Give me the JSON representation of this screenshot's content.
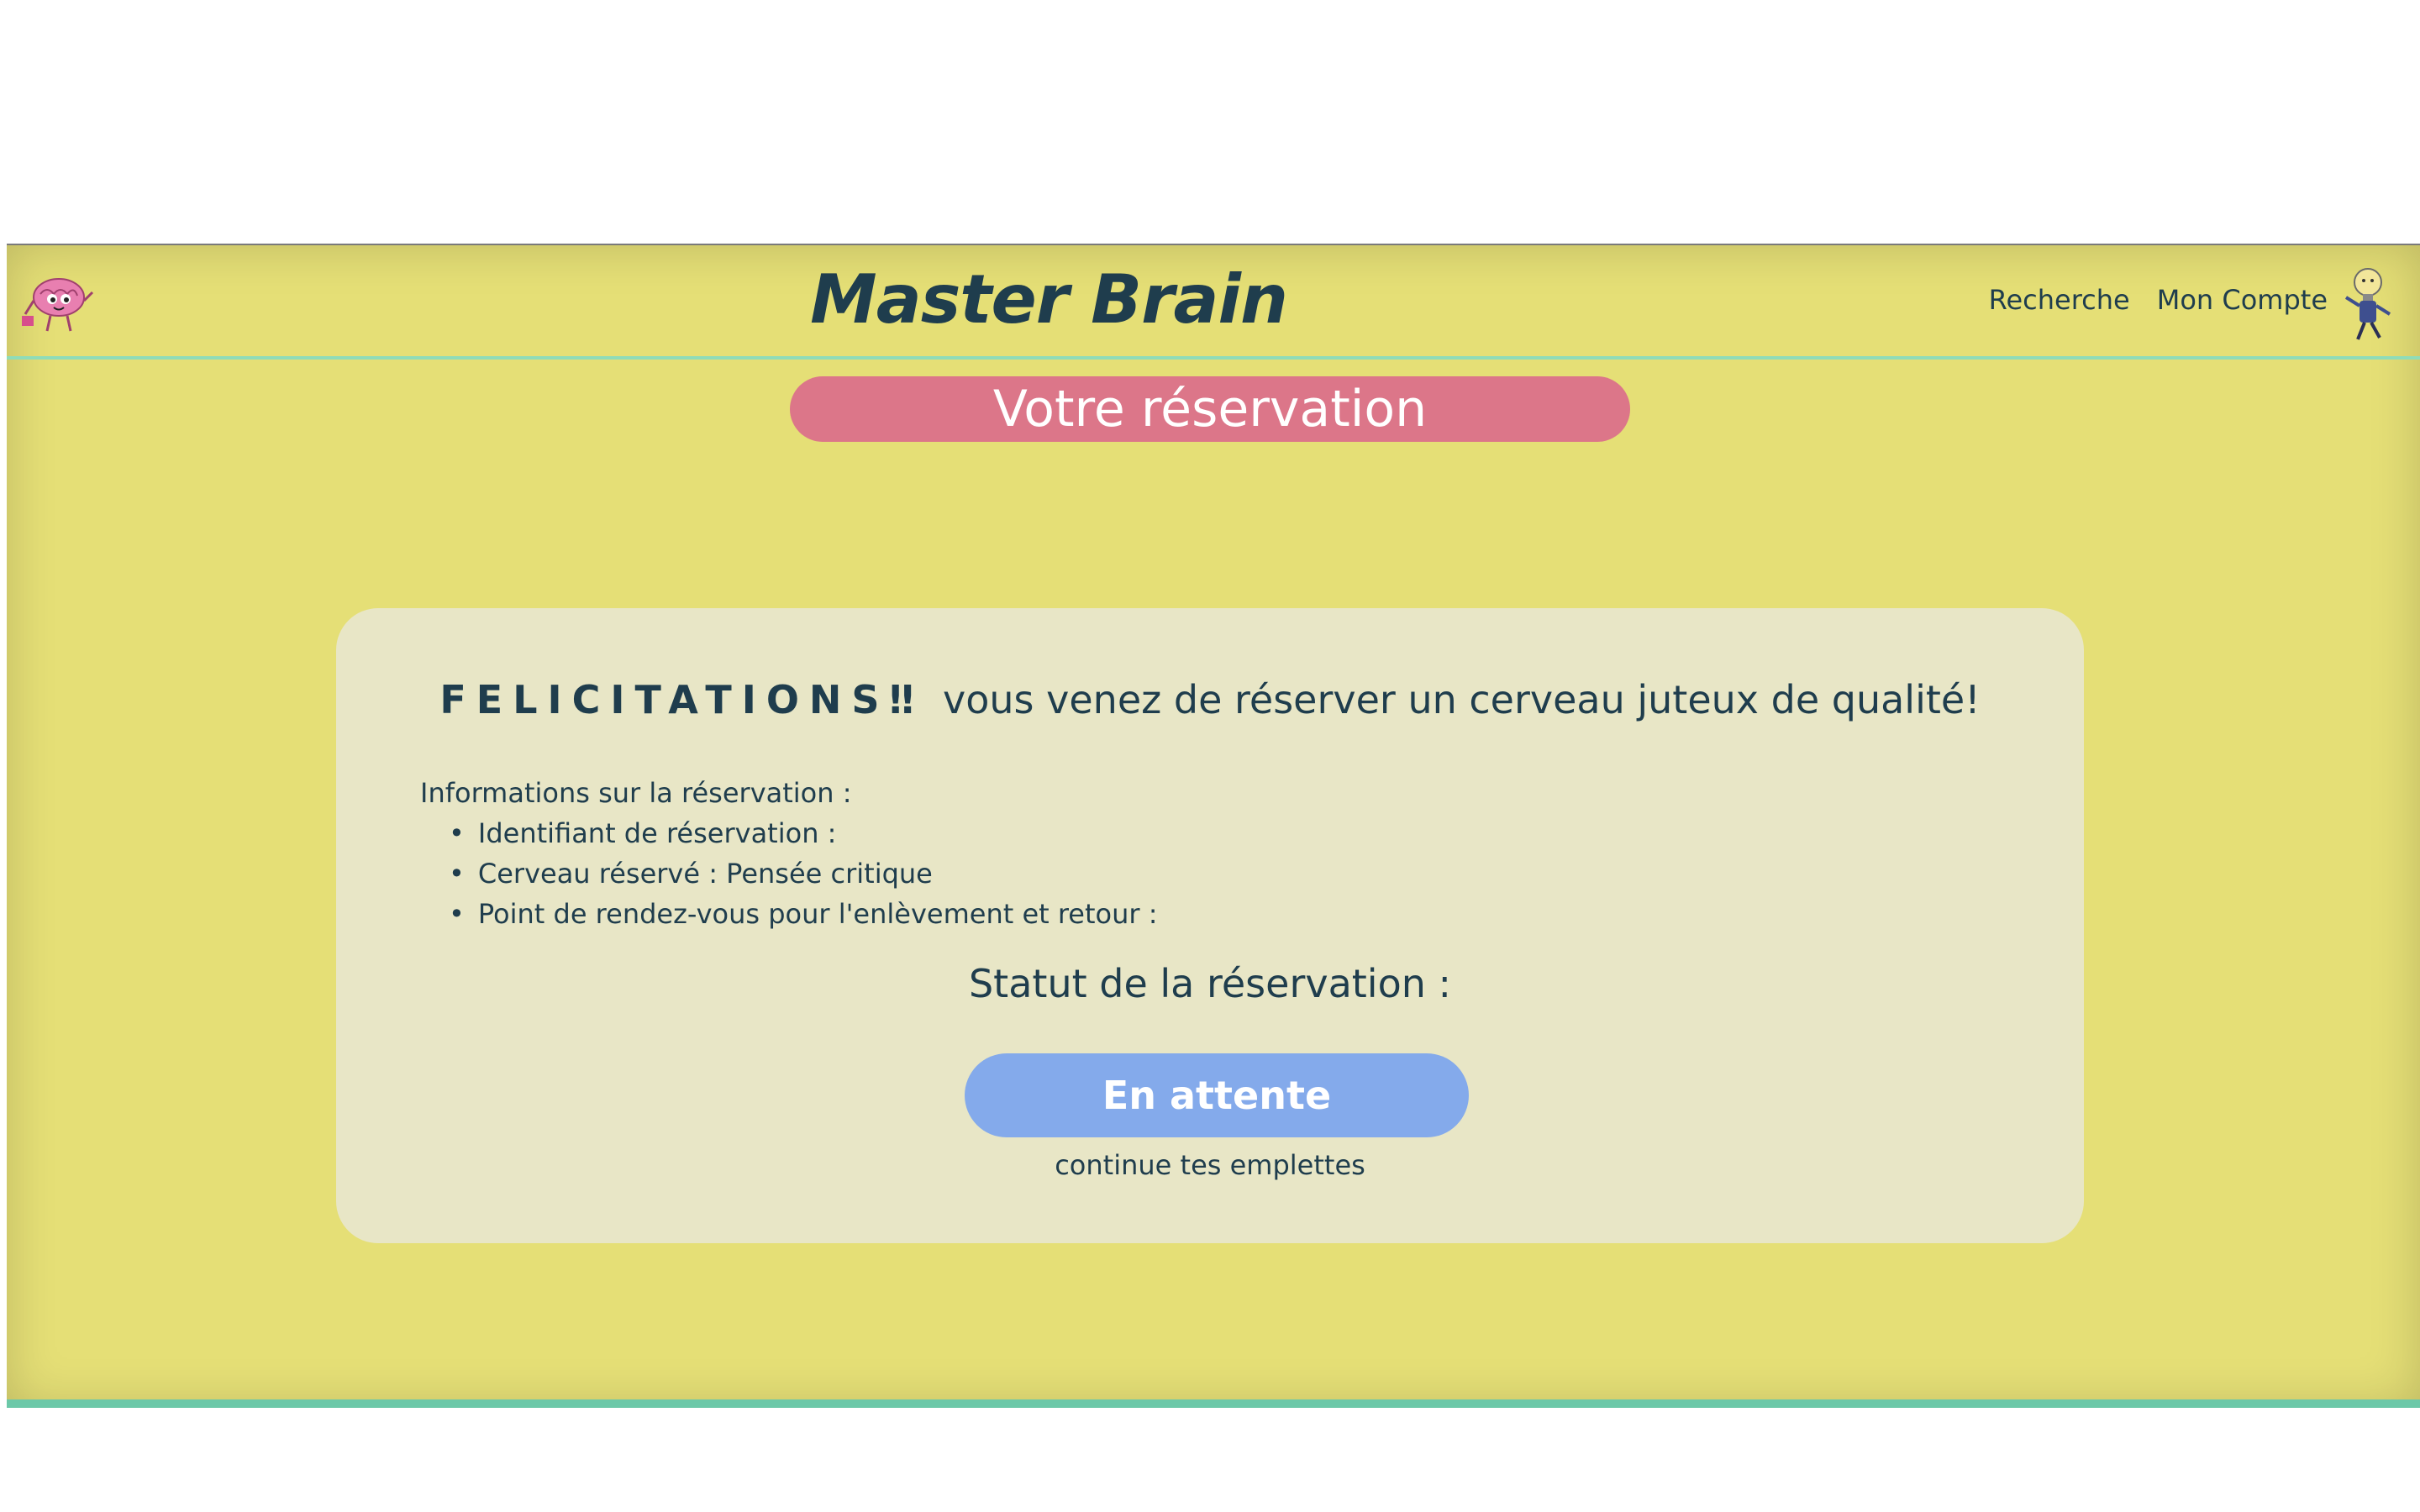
{
  "header": {
    "title": "Master Brain",
    "nav": [
      {
        "label": "Recherche"
      },
      {
        "label": "Mon Compte"
      }
    ]
  },
  "page_title": "Votre réservation",
  "confirmation": {
    "felicitations": "FELICITATIONS‼",
    "message": "vous venez de réserver un cerveau juteux de qualité!",
    "info_heading": "Informations sur la réservation :",
    "items": [
      "Identifiant de réservation :",
      "Cerveau réservé : Pensée critique",
      "Point de rendez-vous pour l'enlèvement et retour :"
    ],
    "status_heading": "Statut de la réservation :",
    "status_label": "En attente",
    "continue_link": "continue tes emplettes"
  },
  "colors": {
    "background": "#e5df76",
    "card": "#e8e6c6",
    "pill": "#dc7689",
    "status_button": "#84aaeb",
    "text": "#1f3d4d",
    "accent_line": "#8fdcb8"
  },
  "icons": [
    "brain-mascot-icon",
    "lightbulb-character-icon"
  ]
}
